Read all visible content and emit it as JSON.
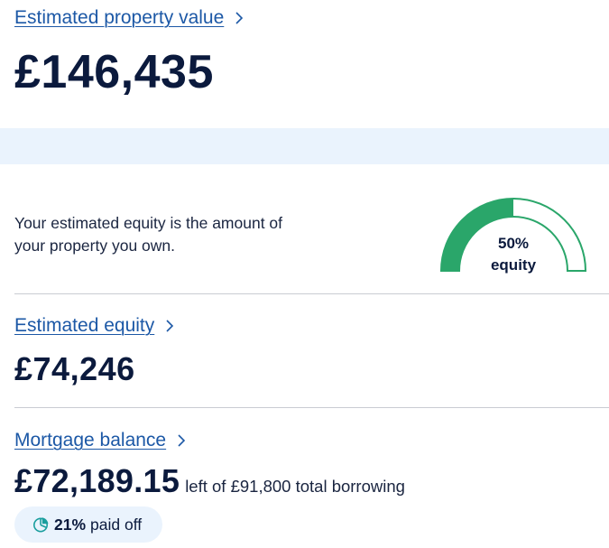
{
  "property": {
    "title": "Estimated property value",
    "value": "£146,435"
  },
  "equity_explainer": {
    "text": "Your estimated equity is the amount of your property you own."
  },
  "gauge": {
    "percent_label": "50%",
    "label": "equity",
    "fraction": 0.5,
    "fill_color": "#2aa66a"
  },
  "equity": {
    "title": "Estimated equity",
    "value": "£74,246"
  },
  "mortgage": {
    "title": "Mortgage balance",
    "value": "£72,189.15",
    "suffix": "left of £91,800 total borrowing",
    "paid_off_percent": "21%",
    "paid_off_label": "paid off"
  },
  "colors": {
    "link": "#1c58a6",
    "text": "#0b1a3d",
    "band": "#eaf3fd",
    "accent": "#2aa66a"
  },
  "icons": {
    "chevron": "chevron-right-icon",
    "pie": "pie-chart-icon"
  }
}
